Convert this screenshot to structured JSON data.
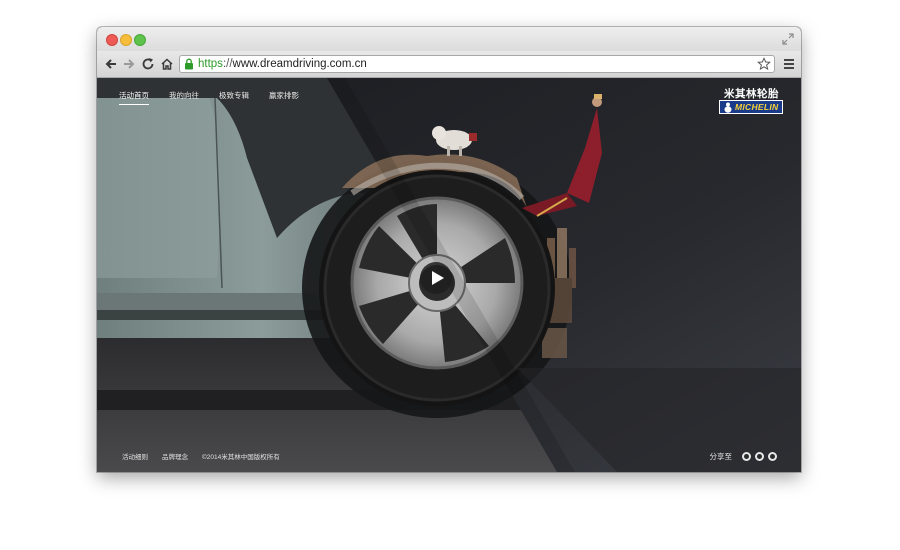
{
  "browser": {
    "url_scheme": "https",
    "url_sep": "://",
    "url_host": "www.dreamdriving.com.cn"
  },
  "site": {
    "nav": [
      "活动首页",
      "我的向往",
      "极致专辑",
      "赢家排影"
    ],
    "active_nav_index": 0,
    "brand_cn": "米其林轮胎",
    "brand_logo": "MICHELIN",
    "footer_links": [
      "活动细则",
      "品牌理念"
    ],
    "copyright": "©2014米其林中国版权所有",
    "share_label": "分享至",
    "share_icons": [
      "weibo-icon",
      "tencent-weibo-icon",
      "douban-icon"
    ]
  },
  "colors": {
    "page_background": "#1c1d20",
    "car_body": "#7f8f8e",
    "road": "#3a3a3a",
    "michelin_blue": "#1a3a8a",
    "michelin_yellow": "#f5d23a",
    "url_green": "#2d9a2a"
  }
}
